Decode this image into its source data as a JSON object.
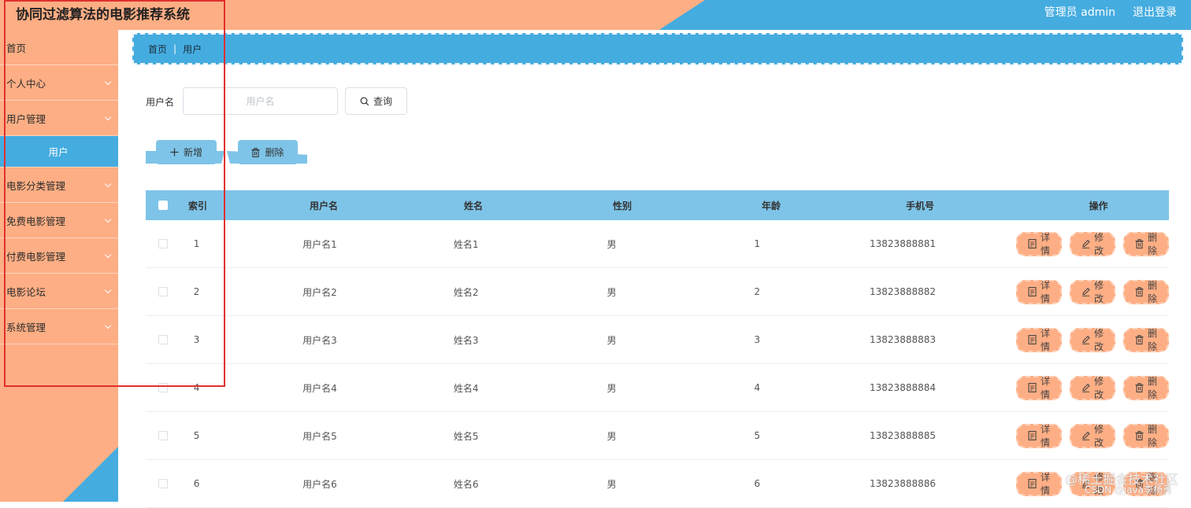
{
  "header": {
    "title": "协同过滤算法的电影推荐系统",
    "user_label": "管理员 admin",
    "logout_label": "退出登录",
    "colors": {
      "orange": "#feae84",
      "blue": "#45ace0"
    }
  },
  "sidebar": {
    "items": [
      {
        "label": "首页",
        "expandable": false,
        "icon": "none"
      },
      {
        "label": "个人中心",
        "expandable": true,
        "icon": "chevron-down-icon"
      },
      {
        "label": "用户管理",
        "expandable": true,
        "icon": "chevron-down-icon"
      },
      {
        "label": "用户",
        "expandable": false,
        "active": true
      },
      {
        "label": "电影分类管理",
        "expandable": true,
        "icon": "chevron-down-icon"
      },
      {
        "label": "免费电影管理",
        "expandable": true,
        "icon": "chevron-down-icon"
      },
      {
        "label": "付费电影管理",
        "expandable": true,
        "icon": "chevron-down-icon"
      },
      {
        "label": "电影论坛",
        "expandable": true,
        "icon": "chevron-down-icon"
      },
      {
        "label": "系统管理",
        "expandable": true,
        "icon": "chevron-down-icon"
      }
    ]
  },
  "breadcrumb": {
    "home": "首页",
    "separator": "|",
    "current": "用户"
  },
  "search": {
    "label": "用户名",
    "value": "",
    "placeholder": "用户名",
    "button_label": "查询",
    "button_icon": "search-icon"
  },
  "actions": {
    "add_label": "新增",
    "add_icon": "plus-icon",
    "delete_label": "删除",
    "delete_icon": "trash-icon"
  },
  "table": {
    "columns": [
      "索引",
      "用户名",
      "姓名",
      "性别",
      "年龄",
      "手机号",
      "操作"
    ],
    "rows": [
      {
        "index": "1",
        "username": "用户名1",
        "name": "姓名1",
        "gender": "男",
        "age": "1",
        "phone": "13823888881"
      },
      {
        "index": "2",
        "username": "用户名2",
        "name": "姓名2",
        "gender": "男",
        "age": "2",
        "phone": "13823888882"
      },
      {
        "index": "3",
        "username": "用户名3",
        "name": "姓名3",
        "gender": "男",
        "age": "3",
        "phone": "13823888883"
      },
      {
        "index": "4",
        "username": "用户名4",
        "name": "姓名4",
        "gender": "男",
        "age": "4",
        "phone": "13823888884"
      },
      {
        "index": "5",
        "username": "用户名5",
        "name": "姓名5",
        "gender": "男",
        "age": "5",
        "phone": "13823888885"
      },
      {
        "index": "6",
        "username": "用户名6",
        "name": "姓名6",
        "gender": "男",
        "age": "6",
        "phone": "13823888886"
      }
    ],
    "row_actions": {
      "detail_label": "详情",
      "detail_icon": "document-icon",
      "edit_label": "修改",
      "edit_icon": "edit-icon",
      "delete_label": "删除",
      "delete_icon": "trash-icon"
    }
  },
  "watermark": {
    "line1": "@稀土掘金技术社区",
    "line2": "CSDN @java李杨勇"
  }
}
